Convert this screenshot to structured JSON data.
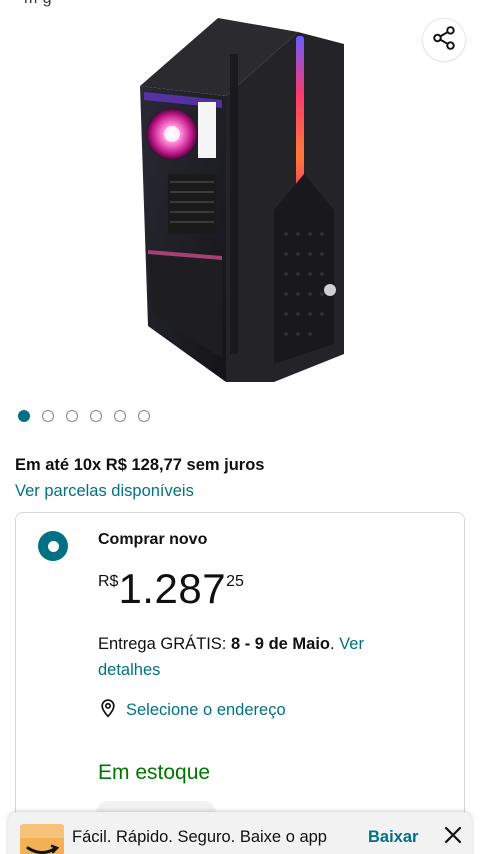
{
  "header": {
    "fragment_text": "m·g"
  },
  "gallery": {
    "dot_count": 6,
    "active_index": 0
  },
  "installments": {
    "text": "Em até 10x R$ 128,77 sem juros",
    "link": "Ver parcelas disponíveis"
  },
  "buy_box": {
    "title": "Comprar novo",
    "price": {
      "currency": "R$",
      "whole": "1.287",
      "cents": "25"
    },
    "delivery": {
      "prefix": "Entrega GRÁTIS: ",
      "dates": "8 - 9 de Maio",
      "suffix": ". ",
      "link": "Ver detalhes"
    },
    "address_link": "Selecione o endereço",
    "stock_status": "Em estoque"
  },
  "app_banner": {
    "text": "Fácil. Rápido. Seguro. Baixe o app",
    "action": "Baixar"
  },
  "colors": {
    "accent": "#007185",
    "stock_green": "#007600",
    "logo_orange": "#f4b054"
  },
  "icons": {
    "share": "share-icon",
    "location": "location-pin-icon",
    "close": "close-icon",
    "app_logo": "amazon-logo-icon"
  }
}
